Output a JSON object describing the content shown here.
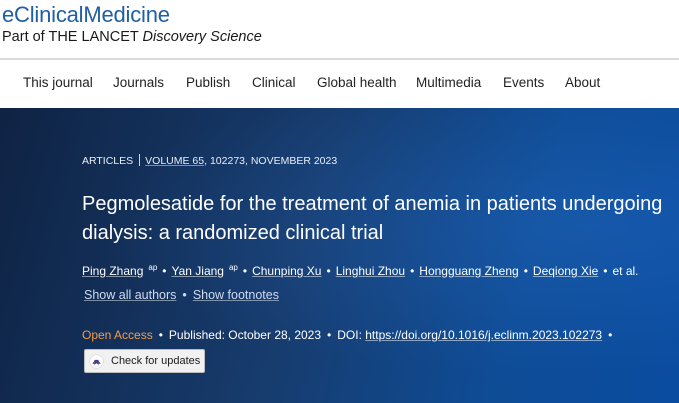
{
  "brand": {
    "name": "eClinicalMedicine",
    "sub_prefix": "Part of THE LANCET",
    "sub_suffix": "Discovery Science"
  },
  "nav": {
    "items": [
      "This journal",
      "Journals",
      "Publish",
      "Clinical",
      "Global health",
      "Multimedia",
      "Events",
      "About"
    ]
  },
  "article": {
    "type": "ARTICLES",
    "volume": "VOLUME 65",
    "issue_info": ", 102273, NOVEMBER 2023",
    "title": "Pegmolesatide for the treatment of anemia in patients undergoing dialysis: a randomized clinical trial",
    "authors": [
      {
        "name": "Ping Zhang",
        "sup": "ap"
      },
      {
        "name": "Yan Jiang",
        "sup": "ap"
      },
      {
        "name": "Chunping Xu",
        "sup": ""
      },
      {
        "name": "Linghui Zhou",
        "sup": ""
      },
      {
        "name": "Hongguang Zheng",
        "sup": ""
      },
      {
        "name": "Deqiong Xie",
        "sup": ""
      }
    ],
    "et_al": "et al.",
    "show_authors": "Show all authors",
    "show_footnotes": "Show footnotes",
    "open_access": "Open Access",
    "published": "Published: October 28, 2023",
    "doi_label": "DOI:",
    "doi": "https://doi.org/10.1016/j.eclinm.2023.102273",
    "check_updates": "Check for updates"
  },
  "colors": {
    "brand_blue": "#1f5fa3",
    "hero_dark": "#0f2344",
    "hero_light": "#0a4ca0",
    "open_access": "#f29b4a"
  },
  "icons": {
    "check_updates": "crossmark-icon"
  }
}
